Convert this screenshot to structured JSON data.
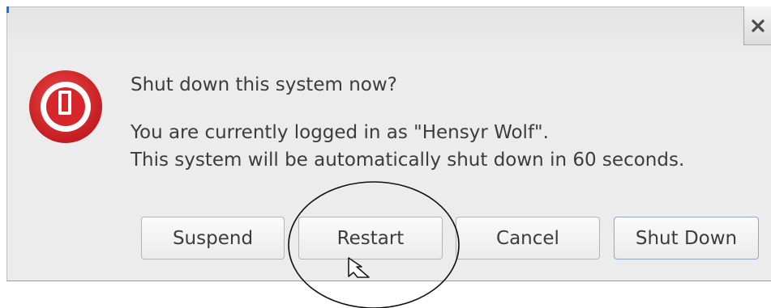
{
  "dialog": {
    "title_message": "Shut down this system now?",
    "line1": "You are currently logged in as \"Hensyr Wolf\".",
    "line2": "This system will be automatically shut down in 60 seconds.",
    "close_icon": "close-icon",
    "warning_icon": "power-warning-icon",
    "accent_color": "#d7262c"
  },
  "buttons": {
    "suspend": "Suspend",
    "restart": "Restart",
    "cancel": "Cancel",
    "shutdown": "Shut Down"
  },
  "cursor": {
    "icon": "arrow-pointer-icon"
  },
  "annotation": {
    "icon": "highlight-ellipse"
  }
}
